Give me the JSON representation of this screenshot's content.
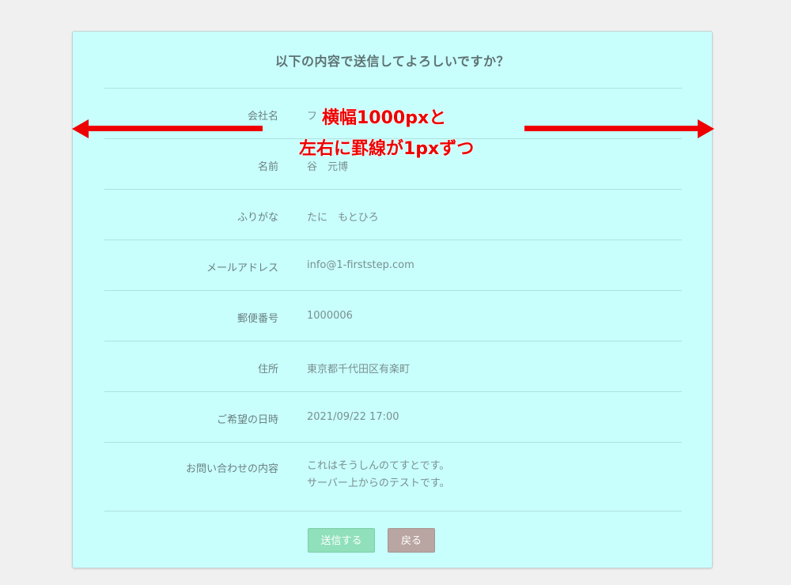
{
  "form": {
    "heading": "以下の内容で送信してよろしいですか？",
    "fields": [
      {
        "label": "会社名",
        "value": "フ"
      },
      {
        "label": "名前",
        "value": "谷　元博"
      },
      {
        "label": "ふりがな",
        "value": "たに　もとひろ"
      },
      {
        "label": "メールアドレス",
        "value": "info@1-firststep.com"
      },
      {
        "label": "郵便番号",
        "value": "1000006"
      },
      {
        "label": "住所",
        "value": "東京都千代田区有楽町"
      },
      {
        "label": "ご希望の日時",
        "value": "2021/09/22 17:00"
      },
      {
        "label": "お問い合わせの内容",
        "value_lines": [
          "これはそうしんのてすとです。",
          "サーバー上からのテストです。"
        ]
      }
    ],
    "submit_label": "送信する",
    "back_label": "戻る"
  },
  "annotation": {
    "line1": "横幅1000pxと",
    "line2": "左右に罫線が1pxずつ",
    "color": "#ee0000"
  }
}
